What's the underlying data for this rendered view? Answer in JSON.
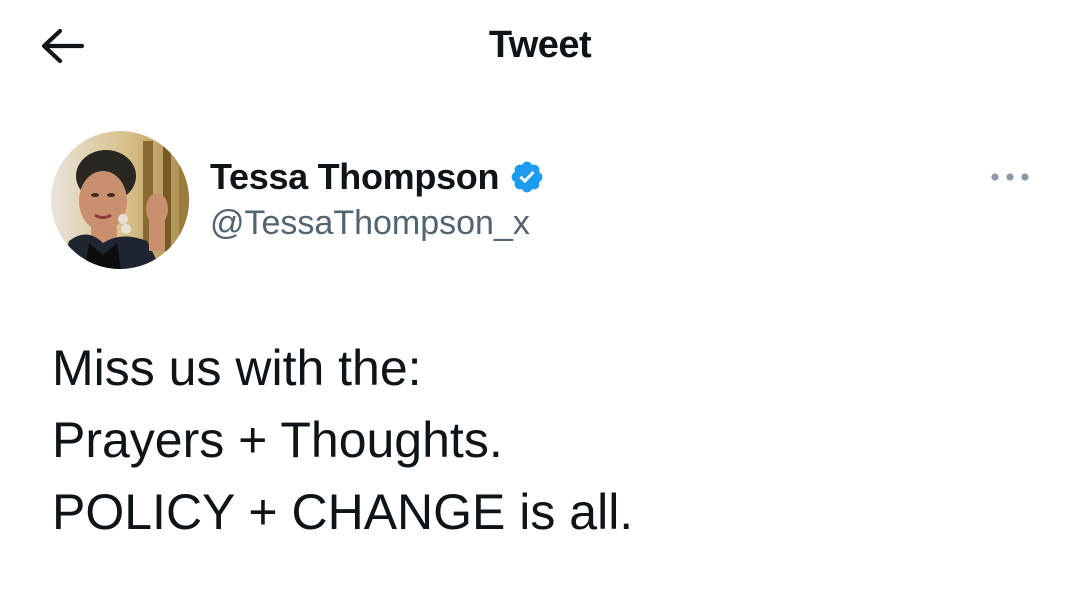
{
  "header": {
    "title": "Tweet",
    "back_icon": "arrow-left-icon"
  },
  "tweet": {
    "author": {
      "name": "Tessa Thompson",
      "handle": "@TessaThompson_x",
      "verified": true,
      "verified_icon": "verified-badge-icon",
      "avatar": "profile-photo"
    },
    "more_icon": "more-horizontal-icon",
    "text_lines": [
      "Miss us with the:",
      "Prayers + Thoughts.",
      "POLICY + CHANGE is all."
    ]
  },
  "colors": {
    "background": "#ffffff",
    "text": "#0f1419",
    "secondary_text": "#536471",
    "verified_blue": "#1d9bf0"
  }
}
